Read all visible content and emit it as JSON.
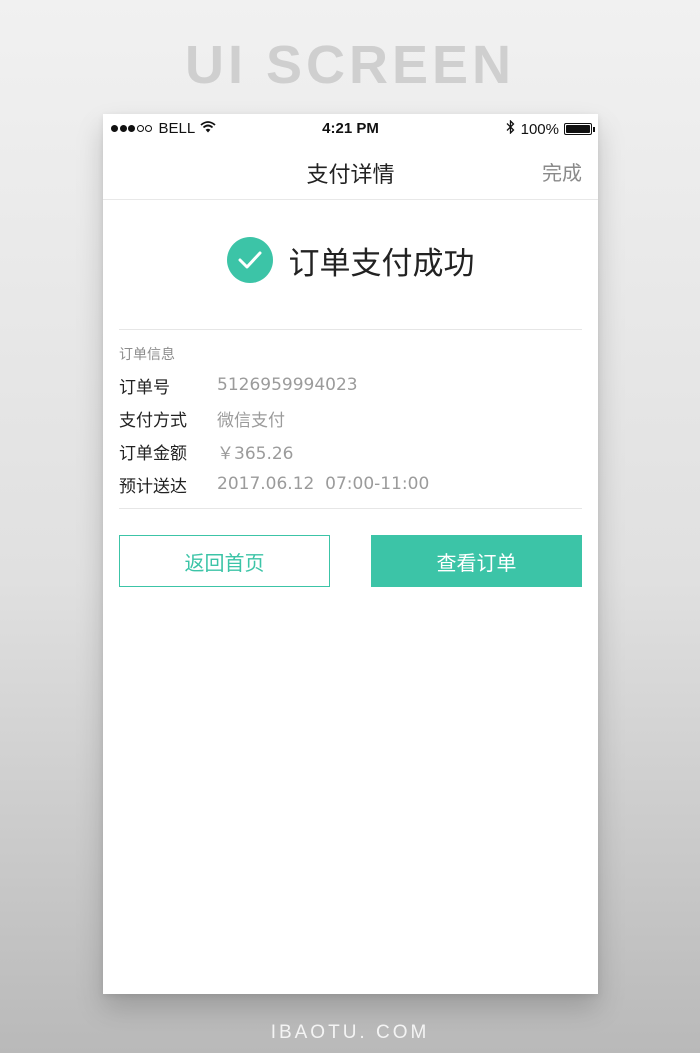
{
  "banner": {
    "title": "UI SCREEN"
  },
  "footer": {
    "brand": "IBAOTU. COM"
  },
  "status_bar": {
    "carrier": "BELL",
    "time": "4:21 PM",
    "battery": "100%"
  },
  "nav": {
    "title": "支付详情",
    "done_label": "完成"
  },
  "success": {
    "message": "订单支付成功"
  },
  "order_info": {
    "section_label": "订单信息",
    "rows": [
      {
        "label": "订单号",
        "value": "5126959994023"
      },
      {
        "label": "支付方式",
        "value": "微信支付"
      },
      {
        "label": "订单金额",
        "value": "￥365.26"
      },
      {
        "label": "预计送达",
        "value": "2017.06.12  07:00-11:00"
      }
    ]
  },
  "actions": {
    "home_label": "返回首页",
    "view_order_label": "查看订单"
  },
  "colors": {
    "accent": "#3cc4a7"
  },
  "icons": {
    "success": "check-circle-icon",
    "wifi": "wifi-icon",
    "bluetooth": "bluetooth-icon",
    "battery": "battery-icon",
    "signal": "signal-icon"
  }
}
